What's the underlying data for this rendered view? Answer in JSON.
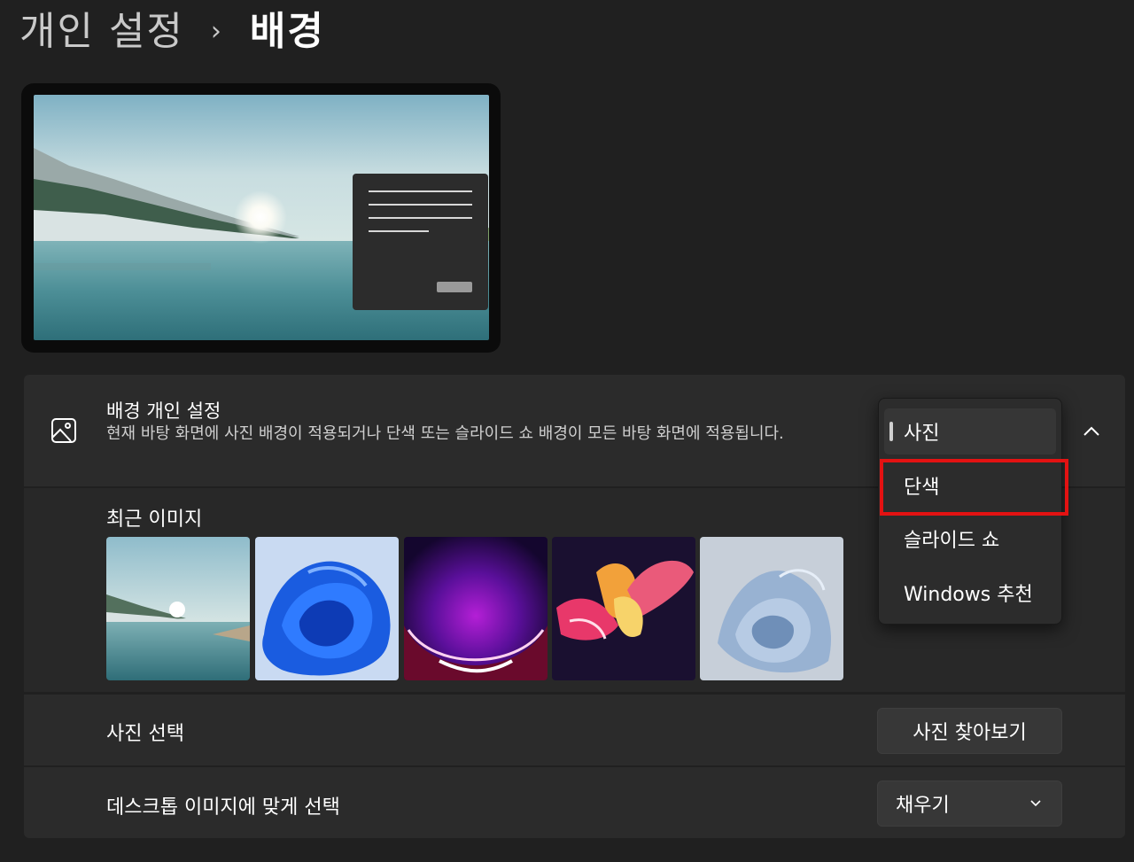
{
  "breadcrumb": {
    "parent": "개인 설정",
    "separator": "›",
    "current": "배경"
  },
  "background_settings": {
    "icon": "image-icon",
    "title": "배경 개인 설정",
    "description": "현재 바탕 화면에 사진 배경이 적용되거나 단색 또는 슬라이드 쇼 배경이 모든 바탕 화면에 적용됩니다.",
    "dropdown": {
      "options": [
        "사진",
        "단색",
        "슬라이드 쇼",
        "Windows 추천"
      ],
      "selected_index": 0,
      "highlighted_index": 1,
      "highlight_color": "#e31212"
    },
    "expand_icon": "chevron-up-icon"
  },
  "recent_images": {
    "title": "최근 이미지",
    "items": [
      "lake-sunrise",
      "blue-bloom",
      "purple-glow",
      "colorful-ribbons",
      "pale-bloom"
    ]
  },
  "choose_photo": {
    "label": "사진 선택",
    "button_label": "사진 찾아보기"
  },
  "fit": {
    "label": "데스크톱 이미지에 맞게 선택",
    "selected": "채우기",
    "icon": "chevron-down-icon"
  },
  "colors": {
    "background": "#202020",
    "card": "#2b2b2b",
    "accent_highlight": "#e31212"
  }
}
